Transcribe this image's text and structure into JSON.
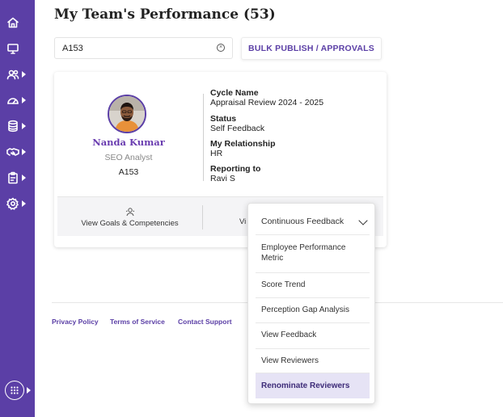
{
  "page": {
    "title": "My Team's Performance (53)"
  },
  "sidebar": {
    "items": [
      {
        "icon": "home-icon"
      },
      {
        "icon": "monitor-icon"
      },
      {
        "icon": "team-icon"
      },
      {
        "icon": "dashboard-gauge-icon"
      },
      {
        "icon": "database-icon"
      },
      {
        "icon": "handshake-icon"
      },
      {
        "icon": "clipboard-icon"
      },
      {
        "icon": "settings-icon"
      }
    ],
    "apps_icon": "apps-grid-icon",
    "accent_color": "#5b3fa6"
  },
  "search": {
    "value": "A153",
    "clear_icon": "clear-icon"
  },
  "toolbar": {
    "bulk_label": "BULK PUBLISH / APPROVALS"
  },
  "employee": {
    "name": "Nanda Kumar",
    "role": "SEO Analyst",
    "id": "A153",
    "cycle_label": "Cycle Name",
    "cycle_value": "Appraisal Review 2024 - 2025",
    "status_label": "Status",
    "status_value": "Self Feedback",
    "relationship_label": "My Relationship",
    "relationship_value": "HR",
    "reporting_label": "Reporting to",
    "reporting_value": "Ravi S"
  },
  "card_actions": {
    "goals_label": "View Goals & Competencies",
    "second_label": "Vi"
  },
  "dropdown": {
    "header": "Continuous Feedback",
    "items": [
      "Employee Performance Metric",
      "Score Trend",
      "Perception Gap Analysis",
      "View Feedback",
      "View Reviewers",
      "Renominate Reviewers"
    ]
  },
  "footer": {
    "privacy": "Privacy Policy",
    "terms": "Terms of Service",
    "support": "Contact Support"
  }
}
